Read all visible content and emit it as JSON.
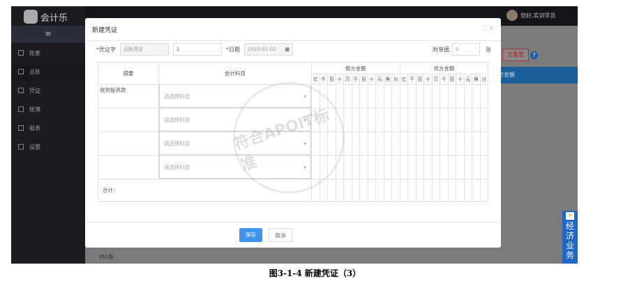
{
  "app": {
    "logo_text": "会计乐",
    "user_greeting": "您好,实训学员",
    "count_text": "共0条",
    "right_button": "去重置",
    "help": "?",
    "blue_bar_text": "方金额",
    "side_tab": {
      "label": "经济业务",
      "icon": "double-chevron-icon",
      "chev": "»"
    }
  },
  "sidebar": {
    "menu_icon": "≡",
    "items": [
      {
        "label": "账套",
        "icon": "ledger-icon"
      },
      {
        "label": "总账",
        "icon": "general-ledger-icon"
      },
      {
        "label": "凭证",
        "icon": "voucher-icon"
      },
      {
        "label": "账簿",
        "icon": "book-icon"
      },
      {
        "label": "报表",
        "icon": "chart-icon"
      },
      {
        "label": "设置",
        "icon": "settings-icon"
      }
    ]
  },
  "modal": {
    "title": "新建凭证",
    "expand": "⛶",
    "close": "×",
    "form": {
      "voucher_word_label": "凭证字",
      "voucher_word_value": "记账凭证",
      "voucher_no": "1",
      "date_label": "日期",
      "date_value": "2020-01-02",
      "attach_label": "附单据",
      "attach_value": "0",
      "attach_unit": "张"
    },
    "table": {
      "headers": {
        "summary": "摘要",
        "account": "会计科目",
        "debit": "借方金额",
        "credit": "贷方金额"
      },
      "digits": [
        "亿",
        "千",
        "百",
        "十",
        "万",
        "千",
        "百",
        "十",
        "元",
        "角",
        "分"
      ],
      "rows": [
        {
          "summary": "收到投资款",
          "account_placeholder": "请选择科目"
        },
        {
          "summary": "",
          "account_placeholder": "请选择科目"
        },
        {
          "summary": "",
          "account_placeholder": "请选择科目"
        },
        {
          "summary": "",
          "account_placeholder": "请选择科目"
        }
      ],
      "total_label": "合计："
    },
    "save": "保存",
    "cancel": "取消"
  },
  "watermark": "符合APOIT标准",
  "caption": "图3-1-4 新建凭证（3）"
}
